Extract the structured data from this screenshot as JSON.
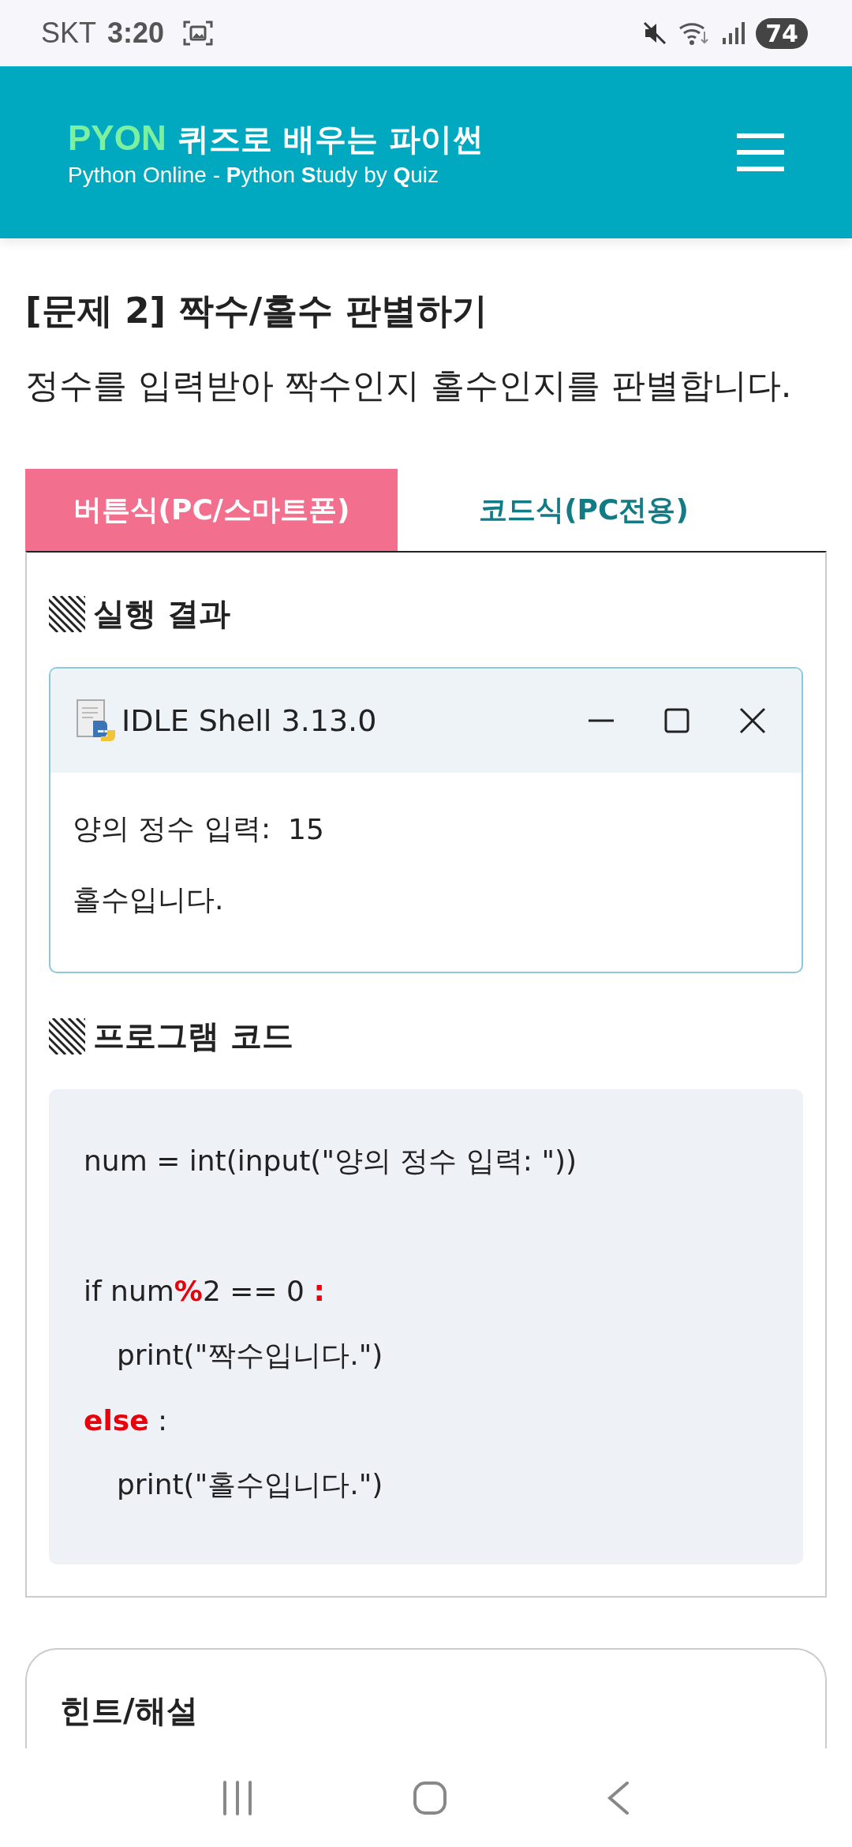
{
  "status_bar": {
    "carrier": "SKT",
    "time": "3:20",
    "battery": "74"
  },
  "header": {
    "brand": "PYON",
    "tagline": "퀴즈로 배우는 파이썬",
    "subtitle": "Python Online - **P**ython **S**tudy by **Q**uiz"
  },
  "problem": {
    "title": "[문제 2] 짝수/홀수 판별하기",
    "description": "정수를 입력받아 짝수인지 홀수인지를 판별합니다."
  },
  "tabs": [
    {
      "label": "버튼식(PC/스마트폰)",
      "selected": true
    },
    {
      "label": "코드식(PC전용)",
      "selected": false
    }
  ],
  "result_section": {
    "heading": "실행 결과",
    "window_title": "IDLE Shell 3.13.0",
    "output": [
      {
        "prompt": "양의 정수 입력:",
        "value": "15"
      },
      {
        "prompt": "홀수입니다."
      }
    ]
  },
  "code_section": {
    "heading": "프로그램 코드",
    "blocks": [
      {
        "lines": [
          {
            "indent": false,
            "segments": [
              {
                "text": "num = int(input(\"양의 정수 입력: \"))",
                "highlight": false
              }
            ]
          }
        ]
      },
      {
        "lines": [
          {
            "indent": false,
            "segments": [
              {
                "text": "if num",
                "highlight": false
              },
              {
                "text": "%",
                "highlight": true
              },
              {
                "text": "2 == 0 ",
                "highlight": false
              },
              {
                "text": ":",
                "highlight": true
              }
            ]
          },
          {
            "indent": true,
            "segments": [
              {
                "text": "print(\"짝수입니다.\")",
                "highlight": false
              }
            ]
          },
          {
            "indent": false,
            "segments": [
              {
                "text": "else",
                "highlight": true
              },
              {
                "text": " :",
                "highlight": false
              }
            ]
          },
          {
            "indent": true,
            "segments": [
              {
                "text": "print(\"홀수입니다.\")",
                "highlight": false
              }
            ]
          }
        ]
      }
    ]
  },
  "hint": {
    "heading": "힌트/해설"
  }
}
